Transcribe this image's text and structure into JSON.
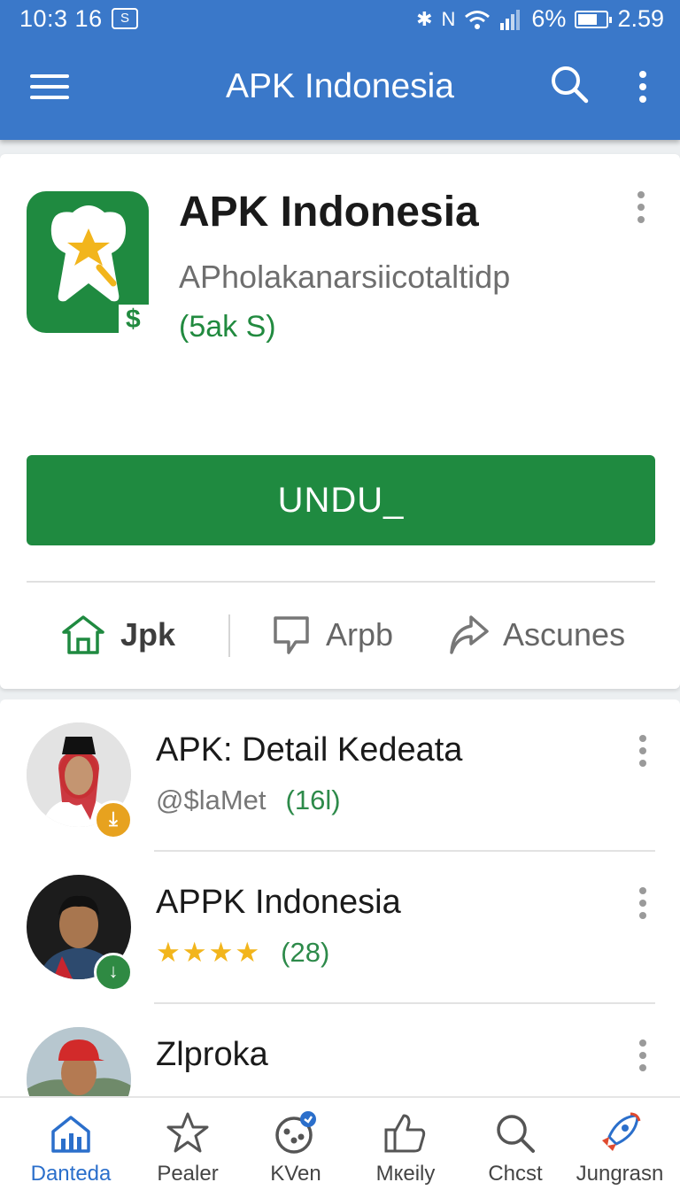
{
  "status": {
    "time": "10:3 16",
    "sim_label": "S",
    "battery_percent": "6%",
    "clock_right": "2.59"
  },
  "appbar": {
    "title": "APK Indonesia"
  },
  "app": {
    "name": "APK Indonesia",
    "developer": "APholakanarsiicotaltidp",
    "size": "(5ak S)",
    "icon_currency": "$",
    "download_label": "UNDU_"
  },
  "actions": [
    {
      "label": "Jpk",
      "icon": "home-icon"
    },
    {
      "label": "Arpb",
      "icon": "comment-icon"
    },
    {
      "label": "Ascunes",
      "icon": "share-icon"
    }
  ],
  "list": [
    {
      "title": "APK: Detail Kedeata",
      "subtitle": "@$laMet",
      "count": "(16l)",
      "badge_color": "#e7a21f",
      "badge_icon": "download-tray-icon"
    },
    {
      "title": "APPK Indonesia",
      "rating_stars": 4,
      "count": "(28)",
      "badge_color": "#2f8a43",
      "badge_icon": "download-arrow-icon"
    },
    {
      "title": "Zlproka"
    }
  ],
  "bottom_nav": [
    {
      "label": "Dantеda",
      "icon": "home-chart-icon",
      "active": true
    },
    {
      "label": "Pealer",
      "icon": "star-icon",
      "active": false
    },
    {
      "label": "KVen",
      "icon": "palette-icon",
      "active": false
    },
    {
      "label": "Mкеily",
      "icon": "thumbs-up-icon",
      "active": false
    },
    {
      "label": "Chcst",
      "icon": "search-icon",
      "active": false
    },
    {
      "label": "Jungrasn",
      "icon": "rocket-icon",
      "active": false
    }
  ],
  "colors": {
    "primary": "#3a78c9",
    "accent_green": "#1f8a40",
    "star": "#f2b51c"
  }
}
